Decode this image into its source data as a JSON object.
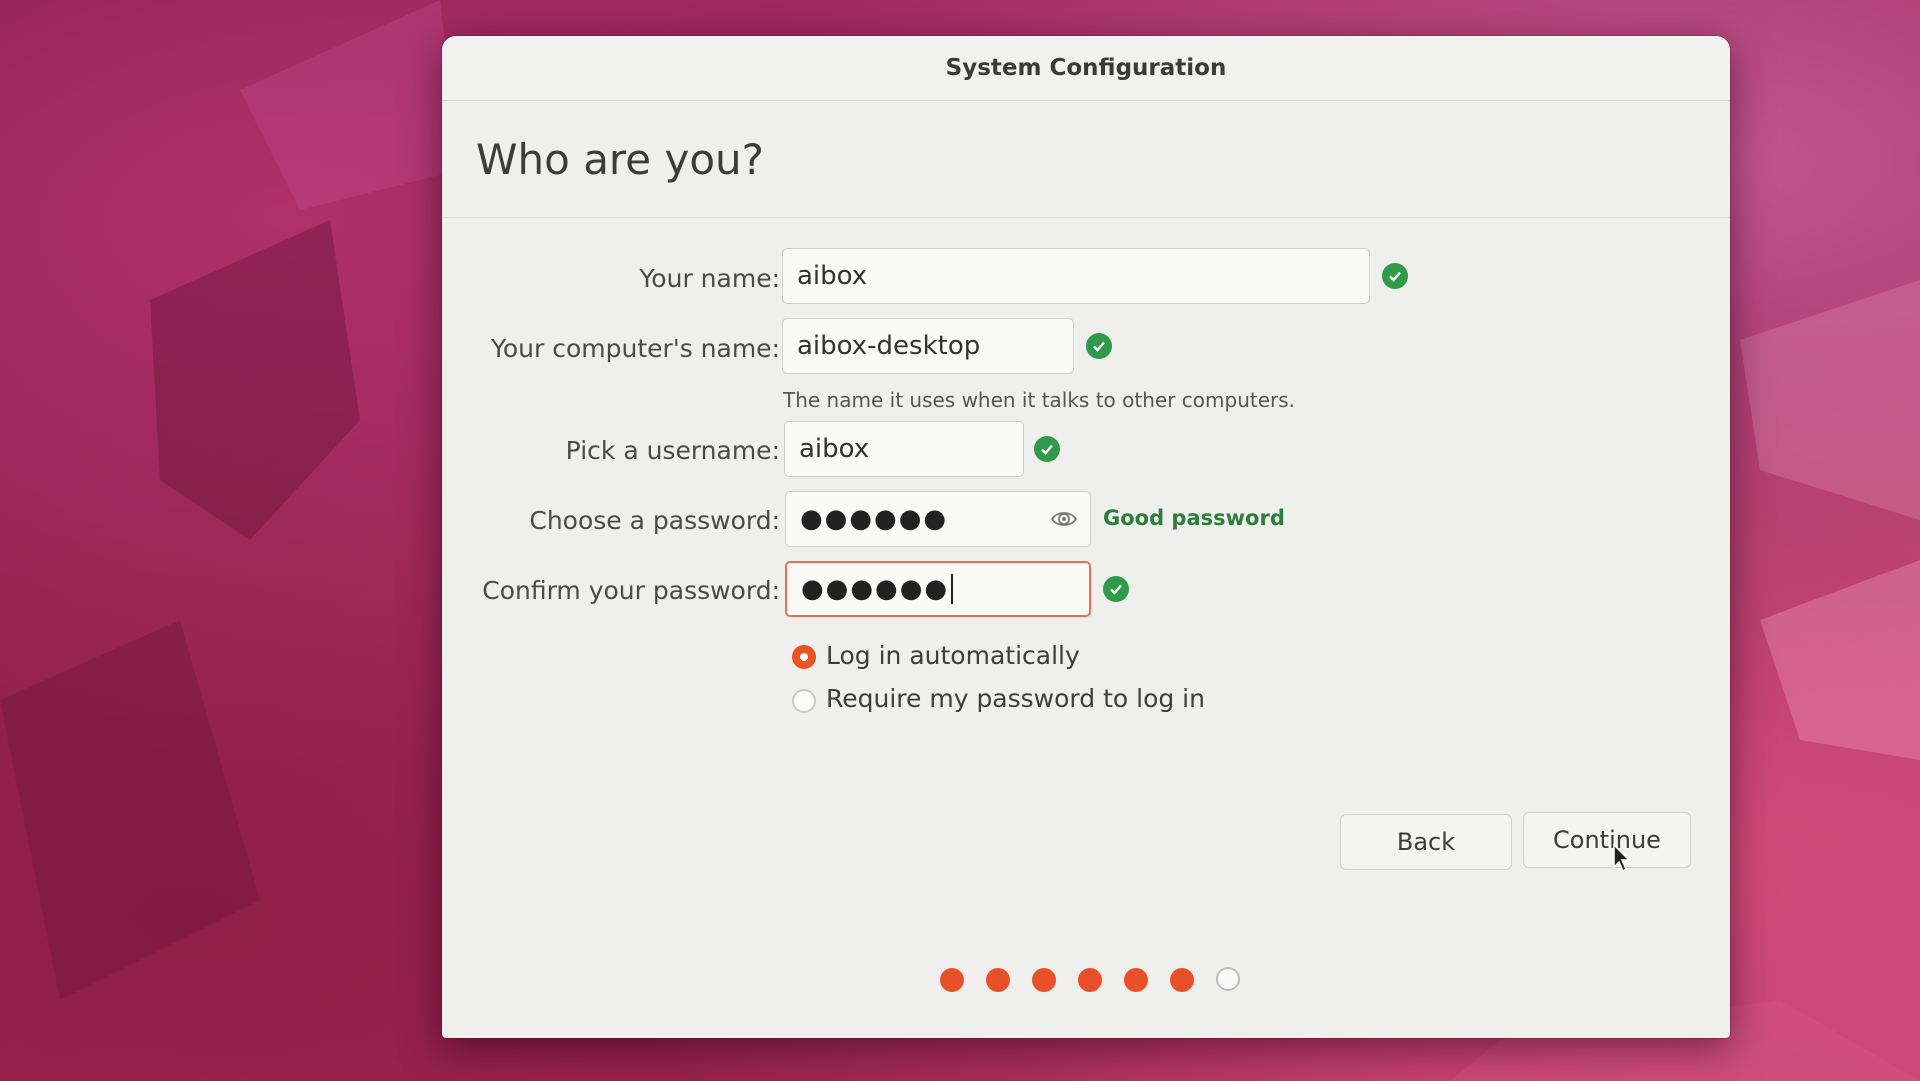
{
  "window": {
    "title": "System Configuration"
  },
  "page": {
    "heading": "Who are you?"
  },
  "form": {
    "name_label": "Your name:",
    "name_value": "aibox",
    "computer_label": "Your computer's name:",
    "computer_value": "aibox-desktop",
    "computer_hint": "The name it uses when it talks to other computers.",
    "username_label": "Pick a username:",
    "username_value": "aibox",
    "password_label": "Choose a password:",
    "password_mask": "●●●●●●",
    "password_strength": "Good password",
    "confirm_label": "Confirm your password:",
    "confirm_mask": "●●●●●●"
  },
  "login_options": {
    "auto_label": "Log in automatically",
    "auto_selected": true,
    "require_label": "Require my password to log in",
    "require_selected": false
  },
  "buttons": {
    "back": "Back",
    "continue": "Continue"
  },
  "progress": {
    "completed_steps": 6,
    "total_steps": 7
  },
  "colors": {
    "accent": "#e95420",
    "valid": "#2e9a4a",
    "strength_text": "#2f7d3a"
  },
  "icons": [
    "check-circle-icon",
    "eye-icon",
    "mouse-pointer-icon"
  ]
}
